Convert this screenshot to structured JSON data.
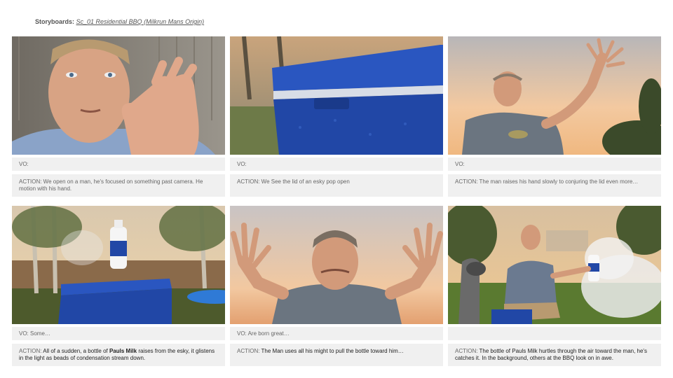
{
  "header": {
    "label": "Storyboards:",
    "title": "Sc_01 Residential BBQ (Milkrun Mans Origin)"
  },
  "panels": [
    {
      "image": "man-gesturing-closeup",
      "vo": "VO:",
      "action_prefix": "ACTION: ",
      "action_text": "We open on a man, he's focused on something past camera. He motion with his hand."
    },
    {
      "image": "blue-esky-lid",
      "vo": "VO:",
      "action_prefix": "ACTION: ",
      "action_text": "We See the lid of an esky pop open"
    },
    {
      "image": "man-raising-hand-sunset",
      "vo": "VO:",
      "action_prefix": "ACTION: ",
      "action_text": "The man raises his hand slowly to conjuring the lid even more…"
    },
    {
      "image": "milk-bottle-rising-from-esky",
      "vo": "VO: Some…",
      "action_prefix": "ACTION: ",
      "action_text_a": "All of a sudden, a bottle of ",
      "action_bold": "Pauls Milk",
      "action_text_b": " raises from the esky, it glistens in the light as beads of condensation stream down."
    },
    {
      "image": "man-pulling-with-both-hands",
      "vo": "VO: Are born great…",
      "action_prefix": "ACTION: ",
      "action_text": "The Man uses all his might to pull the bottle toward him…"
    },
    {
      "image": "man-catching-bottle-bbq",
      "vo": "",
      "action_prefix": "ACTION: ",
      "action_text": " The bottle of Pauls Milk hurtles through the air toward the man, he's catches it. In the background, others at the BBQ look on in awe."
    }
  ],
  "colors": {
    "esky_blue": "#2147a6",
    "panel_bg": "#f0f0f0",
    "sky_sunset": "#f3c9a0"
  }
}
